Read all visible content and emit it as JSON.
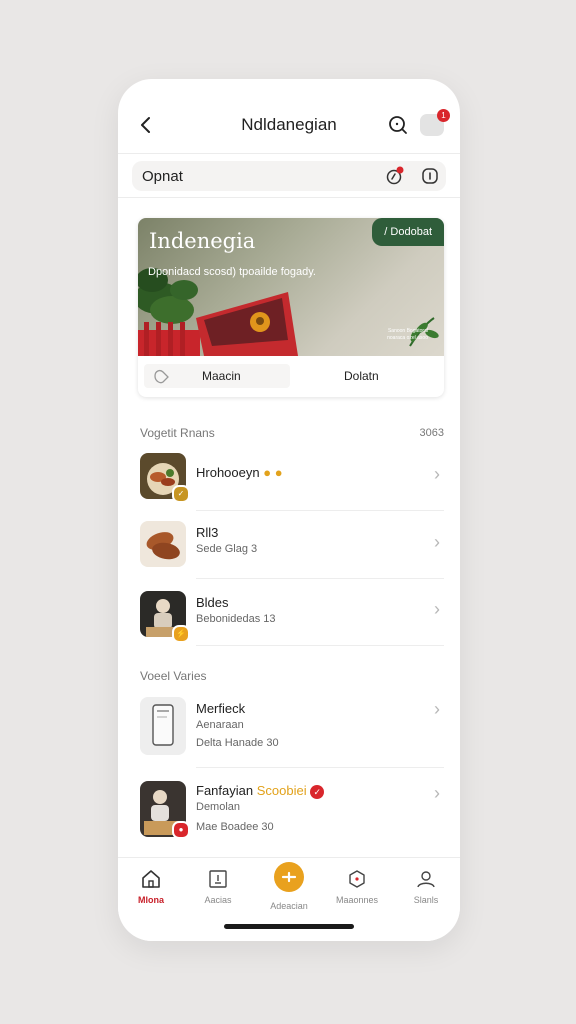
{
  "header": {
    "title": "Ndldanegian",
    "back_icon": "chevron-left-icon",
    "notification_count": "1"
  },
  "search": {
    "label": "Opnat",
    "icon_badge": "1"
  },
  "hero": {
    "title": "Indenegia",
    "subtitle": "Dponidacd scosd) tpoailde fogady.",
    "pill_label": "/ Dodobat",
    "note_line1": "Sanoon Bogatoral",
    "note_line2": "noaraca ozel asoo"
  },
  "card_tabs": {
    "left": "Maacin",
    "right": "Dolatn"
  },
  "section1": {
    "title": "Vogetit Rnans",
    "meta": "3063",
    "items": [
      {
        "title": "Hrohooeyn",
        "subtitle": "",
        "chevron": "›"
      },
      {
        "title": "Rll3",
        "subtitle": "Sede Glag 3",
        "chevron": "›"
      },
      {
        "title": "Bldes",
        "subtitle": "Bebonidedas 13",
        "chevron": "›"
      }
    ]
  },
  "section2": {
    "title": "Voeel Varies",
    "items": [
      {
        "title": "Merfieck",
        "line2": "Aenaraan",
        "line3": "Delta Hanade 30",
        "chevron": "›"
      },
      {
        "title": "Fanfayian",
        "highlight": "Scoobiei",
        "line2": "Demolan",
        "line3": "Mae Boadee 30",
        "chevron": "›"
      }
    ]
  },
  "bottom_nav": {
    "items": [
      {
        "label": "Mlona",
        "icon": "home-icon"
      },
      {
        "label": "Aacias",
        "icon": "calendar-icon"
      },
      {
        "label": "Adeacian",
        "icon": "add-icon"
      },
      {
        "label": "Maaonnes",
        "icon": "shield-icon"
      },
      {
        "label": "Slanls",
        "icon": "profile-icon"
      }
    ]
  },
  "colors": {
    "accent": "#e9a11e",
    "brand_green": "#2f5d3a",
    "alert_red": "#d9262c",
    "active_nav": "#c8202a"
  }
}
